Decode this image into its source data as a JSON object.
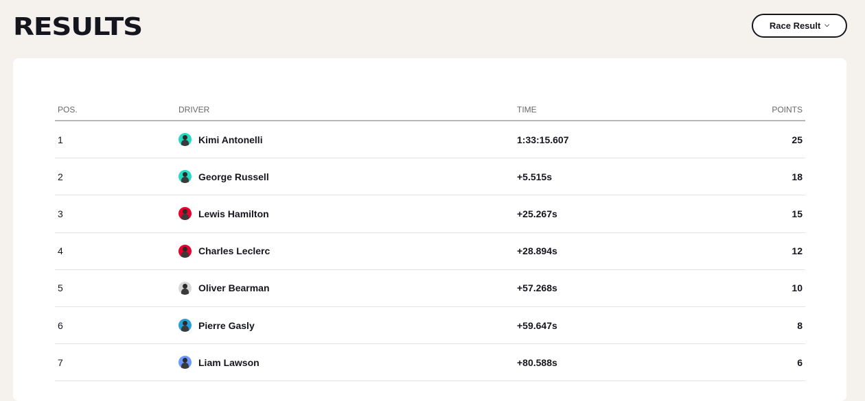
{
  "header": {
    "title": "RESULTS"
  },
  "dropdown": {
    "selected": "Race Result"
  },
  "table": {
    "columns": {
      "pos": "POS.",
      "driver": "DRIVER",
      "time": "TIME",
      "points": "POINTS"
    },
    "rows": [
      {
        "pos": "1",
        "driver": "Kimi Antonelli",
        "time": "1:33:15.607",
        "points": "25",
        "team_color": "#27d9c2"
      },
      {
        "pos": "2",
        "driver": "George Russell",
        "time": "+5.515s",
        "points": "18",
        "team_color": "#27d9c2"
      },
      {
        "pos": "3",
        "driver": "Lewis Hamilton",
        "time": "+25.267s",
        "points": "15",
        "team_color": "#e8002d"
      },
      {
        "pos": "4",
        "driver": "Charles Leclerc",
        "time": "+28.894s",
        "points": "12",
        "team_color": "#e8002d"
      },
      {
        "pos": "5",
        "driver": "Oliver Bearman",
        "time": "+57.268s",
        "points": "10",
        "team_color": "#d8d8d8"
      },
      {
        "pos": "6",
        "driver": "Pierre Gasly",
        "time": "+59.647s",
        "points": "8",
        "team_color": "#2a9fd6"
      },
      {
        "pos": "7",
        "driver": "Liam Lawson",
        "time": "+80.588s",
        "points": "6",
        "team_color": "#6c98ff"
      }
    ]
  }
}
